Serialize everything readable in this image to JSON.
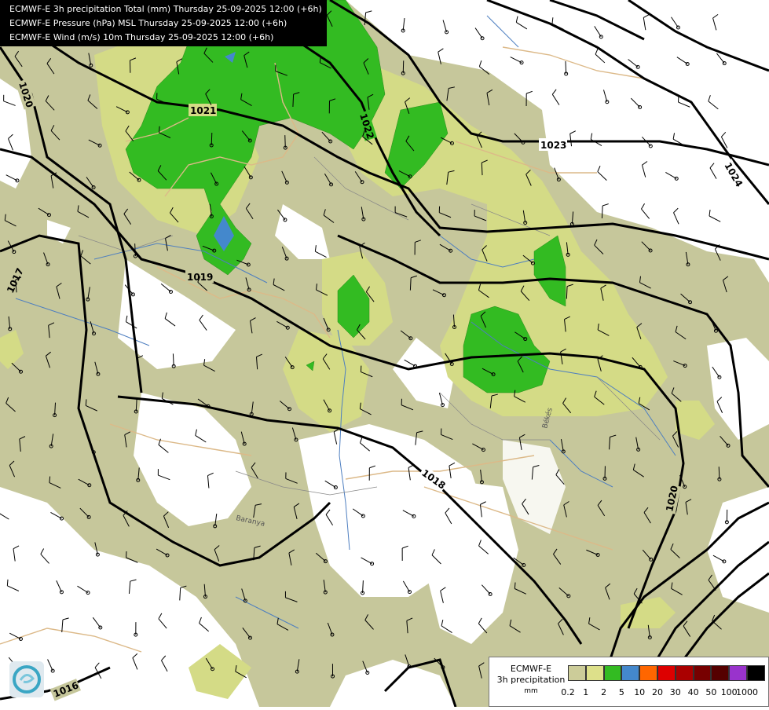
{
  "header": {
    "lines": [
      "ECMWF-E 3h precipitation Total (mm) Thursday 25-09-2025 12:00 (+6h)",
      "ECMWF-E Pressure (hPa) MSL Thursday 25-09-2025 12:00 (+6h)",
      "ECMWF-E Wind (m/s) 10m Thursday 25-09-2025 12:00 (+6h)"
    ]
  },
  "isobars": [
    "1016",
    "1017",
    "1018",
    "1019",
    "1020",
    "1020",
    "1021",
    "1022",
    "1023",
    "1024"
  ],
  "place_labels": [
    "Baranya",
    "Békés"
  ],
  "legend": {
    "title": "ECMWF-E",
    "subtitle": "3h precipitation",
    "unit": "mm",
    "colors": [
      "#cccc99",
      "#dde08a",
      "#33bb22",
      "#4488cc",
      "#ff6600",
      "#dd0000",
      "#aa0000",
      "#770000",
      "#550000",
      "#9933cc",
      "#000000"
    ],
    "ticks": [
      "0.2",
      "1",
      "2",
      "5",
      "10",
      "20",
      "30",
      "40",
      "50",
      "100",
      "1000"
    ]
  },
  "colors": {
    "precip_low": "#c7c99a",
    "precip_mid": "#d5dc88",
    "precip_high": "#33bb22",
    "precip_blue": "#4488cc"
  }
}
